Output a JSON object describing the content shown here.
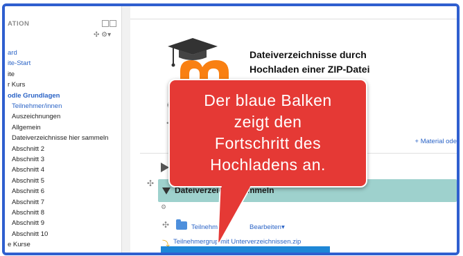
{
  "nav": {
    "title": "ATION",
    "items": [
      {
        "label": "ard",
        "style": "link"
      },
      {
        "label": "ite-Start",
        "style": "link"
      },
      {
        "label": "ite",
        "style": "plain"
      },
      {
        "label": "r Kurs",
        "style": "plain"
      },
      {
        "label": "odle Grundlagen",
        "style": "link-bold"
      },
      {
        "label": "Teilnehmer/innen",
        "style": "link"
      },
      {
        "label": "Auszeichnungen",
        "style": "plain"
      },
      {
        "label": "Allgemein",
        "style": "plain"
      },
      {
        "label": "Dateiverzeichnisse hier sammeln",
        "style": "plain"
      },
      {
        "label": "Abschnitt 2",
        "style": "plain"
      },
      {
        "label": "Abschnitt 3",
        "style": "plain"
      },
      {
        "label": "Abschnitt 4",
        "style": "plain"
      },
      {
        "label": "Abschnitt 5",
        "style": "plain"
      },
      {
        "label": "Abschnitt 6",
        "style": "plain"
      },
      {
        "label": "Abschnitt 7",
        "style": "plain"
      },
      {
        "label": "Abschnitt 8",
        "style": "plain"
      },
      {
        "label": "Abschnitt 9",
        "style": "plain"
      },
      {
        "label": "Abschnitt 10",
        "style": "plain"
      },
      {
        "label": "e Kurse",
        "style": "plain"
      }
    ]
  },
  "main": {
    "course_title": "Dateiverzeichnisse durch Hochladen einer ZIP-Datei",
    "material_link": "+ Material ode",
    "section_title": "Dateiverzeichni                   sammeln",
    "folder_label": "Teilnehmert",
    "edit_label": "Bearbeiten",
    "upload_file": "Teilnehmergrup           mit Unterverzeichnissen.zip",
    "upload_progress_percent": 100
  },
  "callout": {
    "lines": [
      "Der blaue Balken",
      "zeigt den",
      "Fortschritt des",
      "Hochladens an."
    ]
  },
  "colors": {
    "frame_border": "#2f5fcf",
    "callout": "#e53935",
    "section_bar": "#9ed1cd",
    "progress": "#1e87d6",
    "link": "#2a63c6"
  }
}
